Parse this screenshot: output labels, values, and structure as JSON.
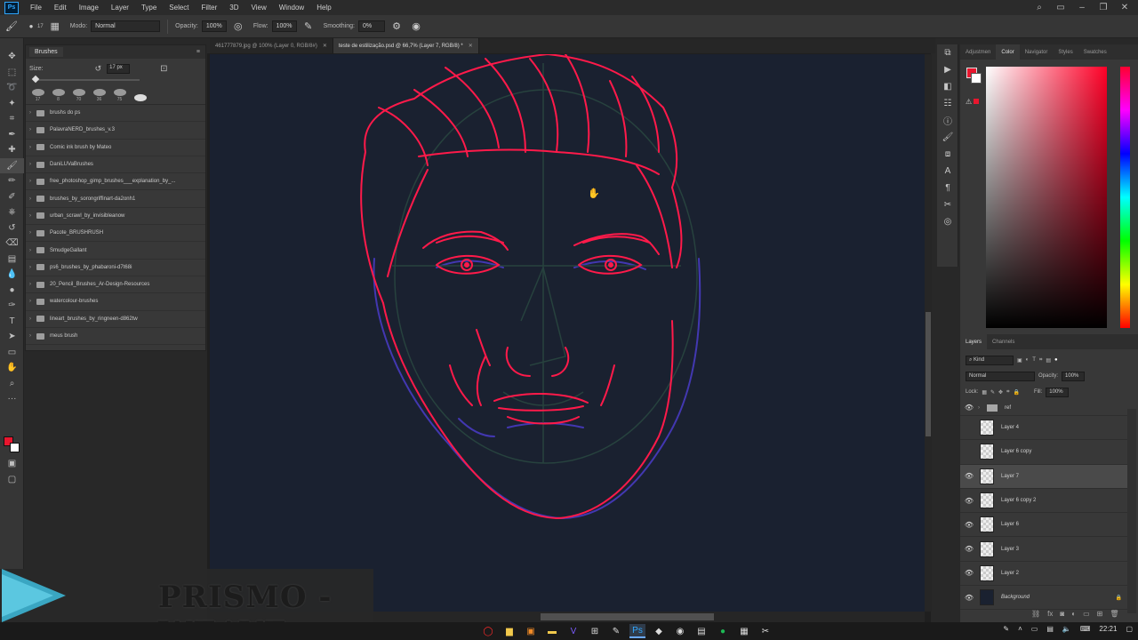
{
  "menu": {
    "logo": "Ps",
    "items": [
      "File",
      "Edit",
      "Image",
      "Layer",
      "Type",
      "Select",
      "Filter",
      "3D",
      "View",
      "Window",
      "Help"
    ]
  },
  "options": {
    "brush_size": "17",
    "mode_label": "Modo:",
    "mode_value": "Normal",
    "opacity_label": "Opacity:",
    "opacity_value": "100%",
    "flow_label": "Flow:",
    "flow_value": "100%",
    "smoothing_label": "Smoothing:",
    "smoothing_value": "0%"
  },
  "documents": {
    "tabs": [
      {
        "label": "461777879.jpg @ 100% (Layer 0, RGB/8#)",
        "active": false
      },
      {
        "label": "teste de estilização.psd @ 66,7% (Layer 7, RGB/8) *",
        "active": true
      }
    ]
  },
  "brush_panel": {
    "title": "Brushes",
    "size_label": "Size:",
    "size_value": "17 px",
    "recent": [
      "17",
      "8",
      "70",
      "36",
      "75",
      ""
    ],
    "folders": [
      "brushs do ps",
      "PalavraNERD_brushes_v.3",
      "Comic ink brush by Mateo",
      "DaniLUVaBrushes",
      "free_photoshop_gimp_brushes___explanation_by_...",
      "brushes_by_sorongriffinart-da2onh1",
      "urban_scrawl_by_invisibleanow",
      "Pacote_BRUSHRUSH",
      "SmudgeGallant",
      "ps6_brushes_by_phabaroni-d7t68i",
      "20_Pencil_Brushes_Ar-Design-Resources",
      "watercolour-brushes",
      "lineart_brushes_by_ringneen-d862tw",
      "meus brush"
    ]
  },
  "right_panels": {
    "color_tabs": [
      "Adjustmen",
      "Color",
      "Navigator",
      "Styles",
      "Swatches"
    ],
    "active_color_tab": "Color",
    "layers_tabs": [
      "Layers",
      "Channels"
    ],
    "kind_label": "Kind",
    "blend_value": "Normal",
    "opacity_label": "Opacity:",
    "opacity_value": "100%",
    "lock_label": "Lock:",
    "fill_label": "Fill:",
    "fill_value": "100%",
    "layers": [
      {
        "name": "ref",
        "type": "folder",
        "visible": true,
        "selected": false
      },
      {
        "name": "Layer 4",
        "type": "layer",
        "visible": false,
        "selected": false
      },
      {
        "name": "Layer 6 copy",
        "type": "layer",
        "visible": false,
        "selected": false
      },
      {
        "name": "Layer 7",
        "type": "layer",
        "visible": true,
        "selected": true
      },
      {
        "name": "Layer 6 copy 2",
        "type": "layer",
        "visible": true,
        "selected": false
      },
      {
        "name": "Layer 6",
        "type": "layer",
        "visible": true,
        "selected": false
      },
      {
        "name": "Layer 3",
        "type": "layer",
        "visible": true,
        "selected": false
      },
      {
        "name": "Layer 2",
        "type": "layer",
        "visible": true,
        "selected": false
      },
      {
        "name": "Background",
        "type": "background",
        "visible": true,
        "selected": false
      }
    ]
  },
  "overlay": {
    "brand": "PRISMO - WEAVE"
  },
  "taskbar": {
    "clock": "22:21"
  },
  "colors": {
    "foreground": "#e8162e",
    "background": "#ffffff",
    "canvas": "#1a2130",
    "sketch_red": "#ff1a4a",
    "sketch_blue": "#4a3cc8",
    "guide": "#27423e"
  }
}
